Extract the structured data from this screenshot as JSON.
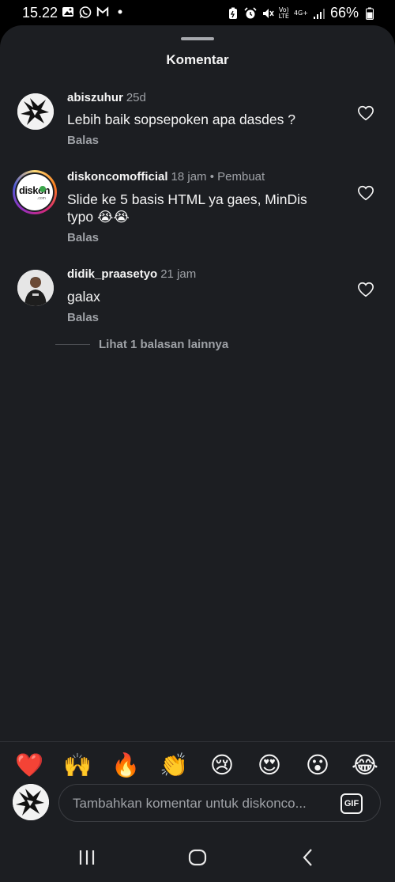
{
  "status_bar": {
    "time": "15.22",
    "battery": "66%",
    "volte_label": "Vo)\nLTE",
    "network": "4G+",
    "icons": [
      "gallery-icon",
      "whatsapp-icon",
      "gmail-icon",
      "dot-icon",
      "battery-saver-icon",
      "alarm-icon",
      "mute-icon",
      "volte-icon",
      "network-icon",
      "signal-icon",
      "battery-icon"
    ]
  },
  "sheet": {
    "title": "Komentar"
  },
  "comments": [
    {
      "username": "abiszuhur",
      "meta": "25d",
      "text": "Lebih baik sopsepoken apa dasdes ?",
      "reply_label": "Balas"
    },
    {
      "username": "diskoncomofficial",
      "meta": "18 jam • Pembuat",
      "text": "Slide ke 5 basis HTML ya gaes, MinDis typo 😭😭",
      "reply_label": "Balas",
      "avatar_logo": "diskon"
    },
    {
      "username": "didik_praasetyo",
      "meta": "21 jam",
      "text": "galax",
      "reply_label": "Balas"
    }
  ],
  "view_more_replies": "Lihat 1 balasan lainnya",
  "quick_emojis": [
    "❤️",
    "🙌",
    "🔥",
    "👏",
    "😢",
    "😍",
    "😮",
    "😂"
  ],
  "composer": {
    "placeholder": "Tambahkan komentar untuk diskonco...",
    "gif_label": "GIF"
  },
  "nav": {
    "buttons": [
      "recents-button",
      "home-button",
      "back-button"
    ]
  }
}
